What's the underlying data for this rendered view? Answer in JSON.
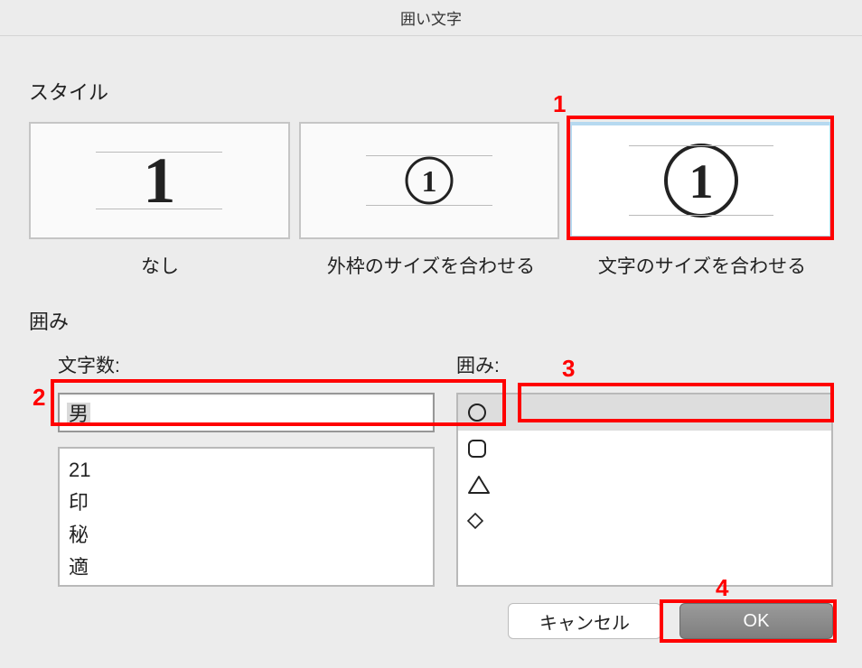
{
  "title": "囲い文字",
  "style": {
    "label": "スタイル",
    "options": [
      {
        "caption": "なし",
        "selected": false
      },
      {
        "caption": "外枠のサイズを合わせる",
        "selected": false
      },
      {
        "caption": "文字のサイズを合わせる",
        "selected": true
      }
    ]
  },
  "enclosure": {
    "label": "囲み",
    "char_count_label": "文字数:",
    "char_value": "男",
    "char_suggestions": [
      "21",
      "印",
      "秘",
      "適"
    ],
    "shape_label": "囲み:",
    "shapes": [
      {
        "name": "circle",
        "selected": true
      },
      {
        "name": "rounded-square",
        "selected": false
      },
      {
        "name": "triangle",
        "selected": false
      },
      {
        "name": "diamond",
        "selected": false
      }
    ]
  },
  "buttons": {
    "cancel": "キャンセル",
    "ok": "OK"
  },
  "annotations": {
    "n1": "1",
    "n2": "2",
    "n3": "3",
    "n4": "4"
  }
}
